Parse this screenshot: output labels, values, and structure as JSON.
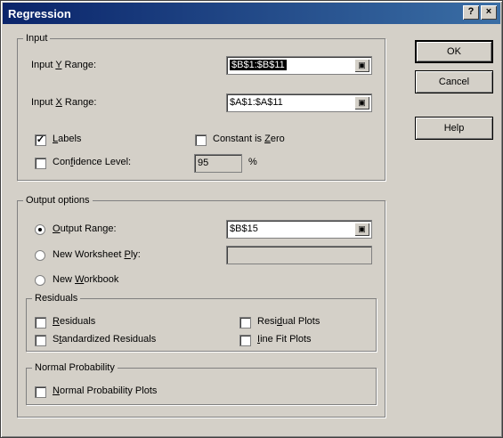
{
  "window": {
    "title": "Regression",
    "help_btn": "?",
    "close_btn": "×"
  },
  "input": {
    "legend": "Input",
    "y_label_pre": "Input ",
    "y_label_key": "Y",
    "y_label_post": " Range:",
    "y_value": "$B$1:$B$11",
    "x_label_pre": "Input ",
    "x_label_key": "X",
    "x_label_post": " Range:",
    "x_value": "$A$1:$A$11",
    "labels_key": "L",
    "labels_rest": "abels",
    "constant_pre": "Constant is ",
    "constant_key": "Z",
    "constant_post": "ero",
    "confidence_pre": "Con",
    "confidence_key": "f",
    "confidence_post": "idence Level:",
    "confidence_value": "95",
    "percent": "%"
  },
  "output": {
    "legend": "Output options",
    "range_key": "O",
    "range_rest": "utput Range:",
    "range_value": "$B$15",
    "new_ws_pre": "New Worksheet ",
    "new_ws_key": "P",
    "new_ws_post": "ly:",
    "new_wb_pre": "New ",
    "new_wb_key": "W",
    "new_wb_post": "orkbook"
  },
  "residuals": {
    "legend": "Residuals",
    "res_key": "R",
    "res_rest": "esiduals",
    "std_pre": "S",
    "std_key": "t",
    "std_post": "andardized Residuals",
    "plots_pre": "Resi",
    "plots_key": "d",
    "plots_post": "ual Plots",
    "line_key": "I",
    "line_post": "ine Fit Plots"
  },
  "normal": {
    "legend": "Normal Probability",
    "plot_pre": "",
    "plot_key": "N",
    "plot_post": "ormal Probability Plots"
  },
  "buttons": {
    "ok": "OK",
    "cancel": "Cancel",
    "help": "Help"
  },
  "state": {
    "labels_checked": true,
    "constant_checked": false,
    "confidence_checked": false,
    "output_selected": "output_range"
  }
}
